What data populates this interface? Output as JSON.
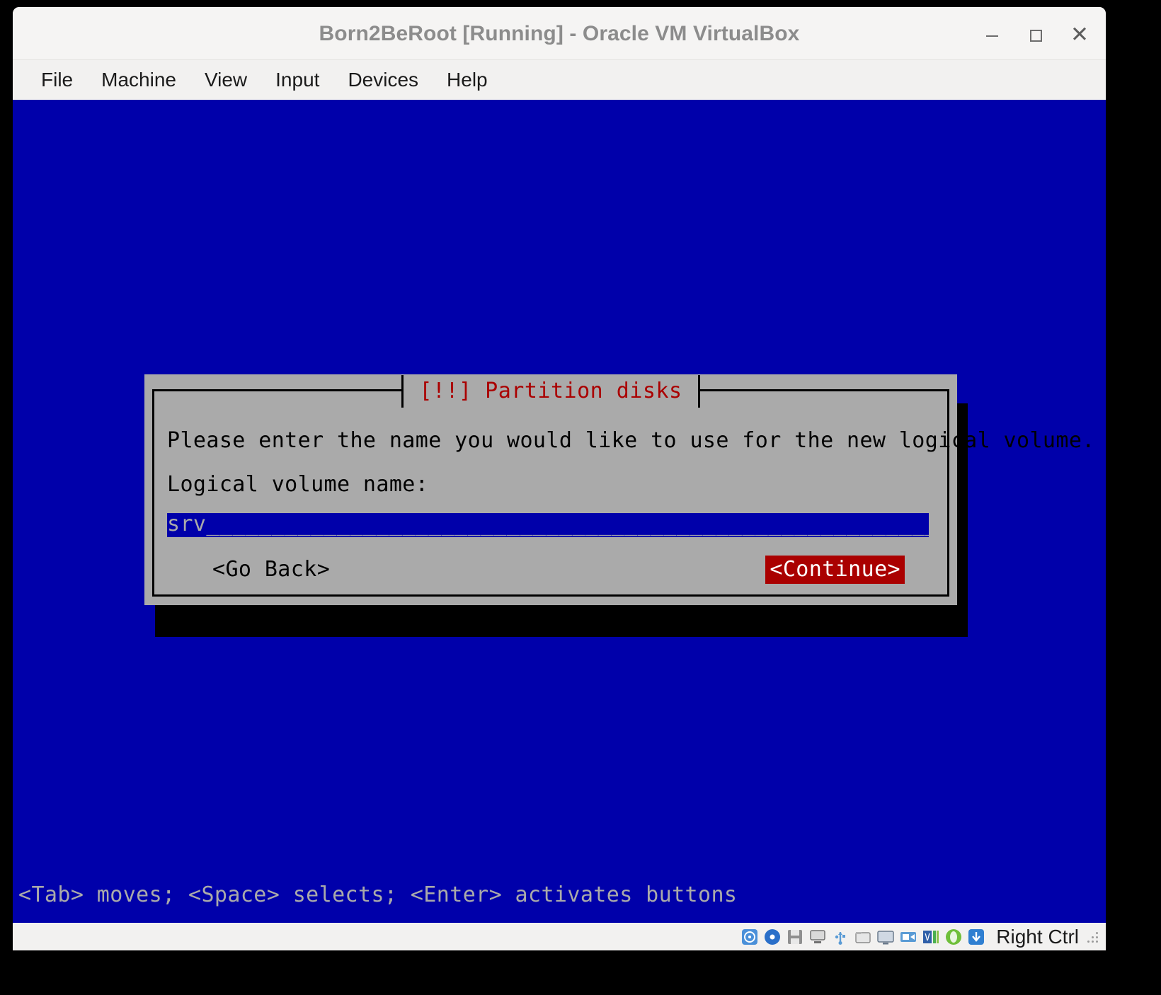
{
  "window": {
    "title": "Born2BeRoot [Running] - Oracle VM VirtualBox",
    "minimize_label": "_",
    "maximize_label": "□",
    "close_label": "✕"
  },
  "menubar": {
    "items": [
      {
        "label": "File",
        "name": "menu-file"
      },
      {
        "label": "Machine",
        "name": "menu-machine"
      },
      {
        "label": "View",
        "name": "menu-view"
      },
      {
        "label": "Input",
        "name": "menu-input"
      },
      {
        "label": "Devices",
        "name": "menu-devices"
      },
      {
        "label": "Help",
        "name": "menu-help"
      }
    ]
  },
  "dialog": {
    "title": "[!!] Partition disks",
    "prompt": "Please enter the name you would like to use for the new logical volume.",
    "field_label": "Logical volume name:",
    "input": {
      "value": "srv",
      "filler": "_______________________________________________________________________"
    },
    "buttons": {
      "go_back": "<Go Back>",
      "continue": "<Continue>"
    }
  },
  "console": {
    "status_line": "<Tab> moves; <Space> selects; <Enter> activates buttons"
  },
  "statusbar": {
    "host_key": "Right Ctrl",
    "icons": [
      "hard-disk-icon",
      "optical-disk-icon",
      "floppy-disk-icon",
      "network-icon",
      "usb-icon",
      "shared-folder-icon",
      "display-icon",
      "recording-icon",
      "virtualization-icon",
      "mouse-integration-icon",
      "keyboard-capture-icon"
    ]
  },
  "colors": {
    "console_background": "#0000aa",
    "dialog_background": "#aaaaaa",
    "dialog_title_red": "#aa0000",
    "continue_button_bg": "#aa0000",
    "chrome_background": "#f2f1f0",
    "title_text": "#8c8c8c"
  }
}
